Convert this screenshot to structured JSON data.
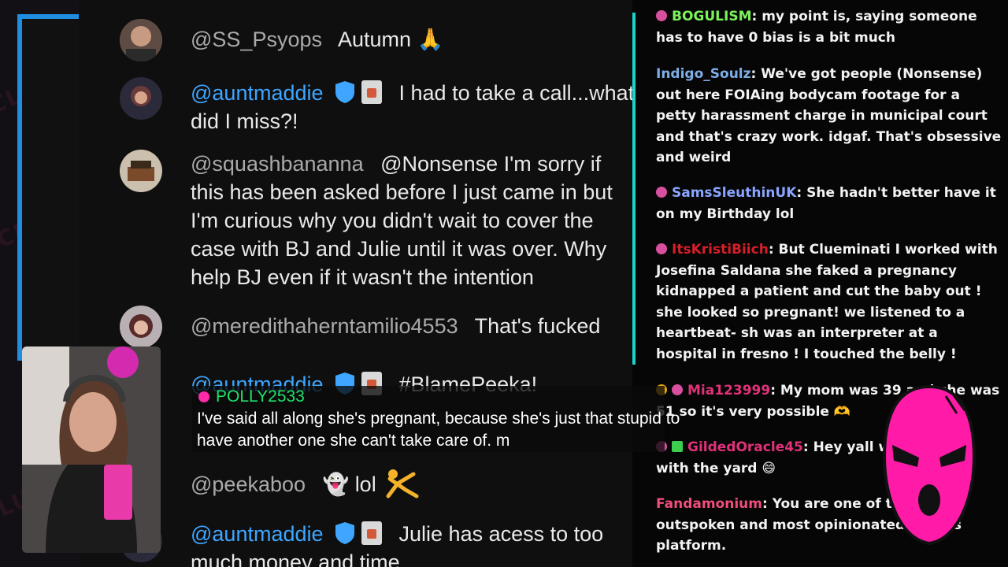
{
  "colors": {
    "youtube_owner": "#3ea6ff",
    "twitch_accent": "#1ad3c8",
    "brand_pink": "#ff1aa8",
    "caption_user": "#1ee36a"
  },
  "youtube_chat": {
    "messages": [
      {
        "user": "@SS_Psyops",
        "text": "Autumn",
        "emoji": "🙏"
      },
      {
        "user": "@auntmaddie",
        "text": "I had to take a call...what did I miss?!"
      },
      {
        "user": "@squashbananna",
        "text": "@Nonsense I'm sorry if this has been asked before I just came in but I'm curious why you didn't wait to cover the case with BJ and Julie until it was over. Why help BJ even if it wasn't the intention"
      },
      {
        "user": "@meredithaherntamilio4553",
        "text": "That's fucked"
      },
      {
        "user": "@auntmaddie",
        "text": "#BlamePeeka!"
      },
      {
        "user": "@peekaboo",
        "text": "lol",
        "emoji": "👻"
      },
      {
        "user": "@auntmaddie",
        "text": "Julie has acess to too much money and time"
      }
    ]
  },
  "twitch_chat": {
    "messages": [
      {
        "user": "BOGULISM",
        "color": "#7cf25b",
        "text": ": my point is, saying someone has to have 0 bias is a bit much"
      },
      {
        "user": "Indigo_Soulz",
        "color": "#7eaee8",
        "text": ": We've got people (Nonsense) out here FOIAing bodycam footage for a petty harassment charge in municipal court and that's crazy work. idgaf. That's obsessive and weird"
      },
      {
        "user": "SamsSleuthinUK",
        "color": "#8aa5ff",
        "text": ": She hadn't better have it on my Birthday lol"
      },
      {
        "user": "ItsKristiBiich",
        "color": "#d61f2a",
        "text": ": But Clueminati I worked with Josefina Saldana she faked a pregnancy kidnapped a patient and cut the baby out ! she looked so pregnant! we listened to a heartbeat- sh was an interpreter at a hospital in fresno ! I touched the belly !"
      },
      {
        "user": "Mia123999",
        "color": "#e0317a",
        "text": ": My mom was 39 and she was 51 so it's very possible 🫶"
      },
      {
        "user": "GildedOracle45",
        "color": "#e0317a",
        "text": ": Hey yall why playing with the yard 😄"
      },
      {
        "user": "Fandamonium",
        "color": "#f04d7c",
        "text": ": You are one of the most outspoken and most opinionated on this platform."
      }
    ]
  },
  "caption": {
    "user": "POLLY2533",
    "text": "I've said all along she's pregnant, because she's just that stupid to have another one she can't take care of. m"
  },
  "watermark": "CLUEMINATI"
}
